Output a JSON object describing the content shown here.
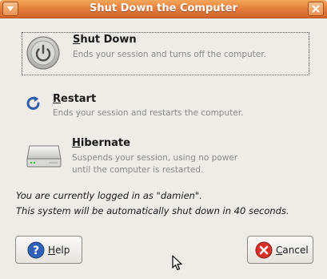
{
  "window": {
    "title": "Shut Down the Computer"
  },
  "options": [
    {
      "id": "shutdown",
      "mnemonic": "S",
      "label_rest": "hut Down",
      "description": "Ends your session and turns off the computer.",
      "icon": "power-icon"
    },
    {
      "id": "restart",
      "mnemonic": "R",
      "label_rest": "estart",
      "description": "Ends your session and restarts the computer.",
      "icon": "restart-icon"
    },
    {
      "id": "hibernate",
      "mnemonic": "H",
      "label_rest": "ibernate",
      "description_line1": "Suspends your session, using no power",
      "description_line2": "until the computer is restarted.",
      "icon": "hard-drive-icon"
    }
  ],
  "info": {
    "line1": "You are currently logged in as \"damien\".",
    "line2": "This system will be automatically shut down in 40 seconds."
  },
  "buttons": {
    "help": {
      "mnemonic": "H",
      "label_rest": "elp",
      "icon": "help-icon"
    },
    "cancel": {
      "mnemonic": "C",
      "label_rest": "ancel",
      "icon": "cancel-icon"
    }
  },
  "colors": {
    "titlebar": "#e2793a",
    "background": "#efebe7",
    "description_text": "#8a8a8a"
  }
}
